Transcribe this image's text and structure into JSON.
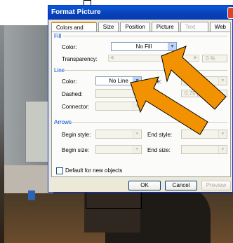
{
  "window": {
    "title": "Format Picture"
  },
  "tabs": [
    {
      "label": "Colors and Lines",
      "state": "active"
    },
    {
      "label": "Size",
      "state": "normal"
    },
    {
      "label": "Position",
      "state": "normal"
    },
    {
      "label": "Picture",
      "state": "normal"
    },
    {
      "label": "Text Box",
      "state": "disabled"
    },
    {
      "label": "Web",
      "state": "normal"
    }
  ],
  "fill": {
    "section": "Fill",
    "color_label": "Color:",
    "color_value": "No Fill",
    "transparency_label": "Transparency:",
    "transparency_value": "0 %"
  },
  "line": {
    "section": "Line",
    "color_label": "Color:",
    "color_value": "No Line",
    "style_label": "Style:",
    "dashed_label": "Dashed:",
    "weight_value": "0.75 pt",
    "connector_label": "Connector:"
  },
  "arrows": {
    "section": "Arrows",
    "begin_style_label": "Begin style:",
    "end_style_label": "End style:",
    "begin_size_label": "Begin size:",
    "end_size_label": "End size:"
  },
  "default_checkbox_label": "Default for new objects",
  "buttons": {
    "ok": "OK",
    "cancel": "Cancel",
    "preview": "Preview"
  },
  "colors": {
    "titlebar": "#0a5bd6",
    "arrow_fill": "#f39200",
    "section_text": "#0046d5"
  }
}
